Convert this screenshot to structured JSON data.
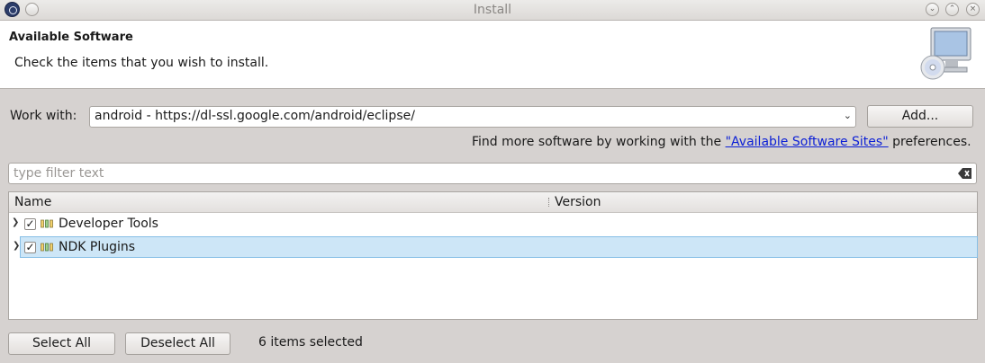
{
  "window": {
    "title": "Install",
    "app_icon": "eclipse-icon",
    "controls": [
      "minimize-icon",
      "maximize-icon",
      "close-icon"
    ]
  },
  "header": {
    "title": "Available Software",
    "description": "Check the items that you wish to install.",
    "banner_icon": "monitor-cd-icon"
  },
  "work_with": {
    "label": "Work with:",
    "value": "android - https://dl-ssl.google.com/android/eclipse/",
    "add_label": "Add..."
  },
  "more_info": {
    "prefix": "Find more software by working with the ",
    "link": "\"Available Software Sites\"",
    "suffix": " preferences."
  },
  "filter": {
    "placeholder": "type filter text",
    "clear_icon": "clear-text-icon"
  },
  "tree": {
    "columns": [
      "Name",
      "Version"
    ],
    "rows": [
      {
        "label": "Developer Tools",
        "checked": true,
        "selected": false,
        "version": ""
      },
      {
        "label": "NDK Plugins",
        "checked": true,
        "selected": true,
        "version": ""
      }
    ]
  },
  "footer": {
    "select_all": "Select All",
    "deselect_all": "Deselect All",
    "status": "6 items selected"
  }
}
